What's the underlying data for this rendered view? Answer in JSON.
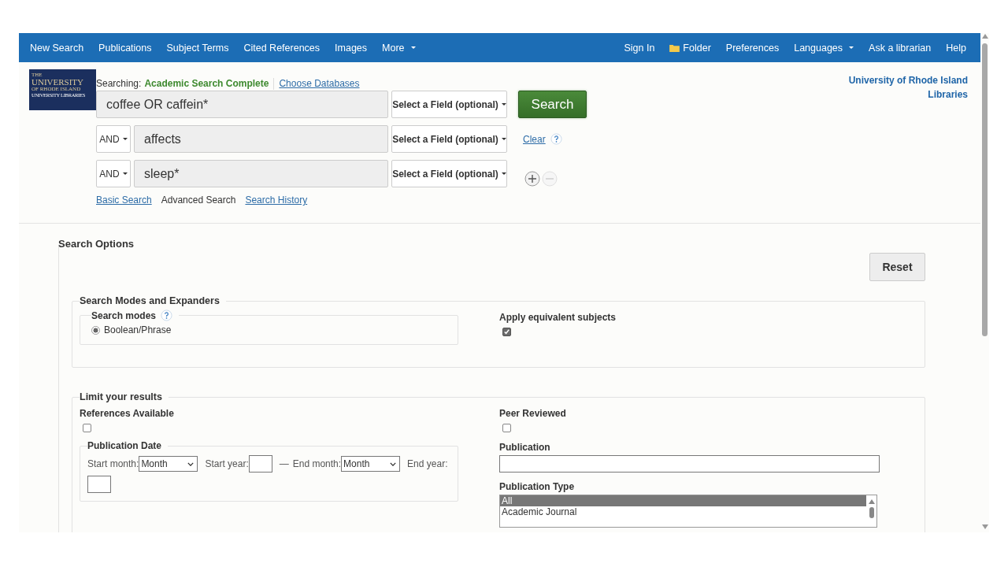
{
  "nav": {
    "left": [
      {
        "label": "New Search",
        "kind": "link"
      },
      {
        "label": "Publications",
        "kind": "link"
      },
      {
        "label": "Subject Terms",
        "kind": "link"
      },
      {
        "label": "Cited References",
        "kind": "link"
      },
      {
        "label": "Images",
        "kind": "link"
      },
      {
        "label": "More",
        "kind": "menu"
      }
    ],
    "right": [
      {
        "label": "Sign In",
        "kind": "link"
      },
      {
        "label": "Folder",
        "kind": "folder"
      },
      {
        "label": "Preferences",
        "kind": "link"
      },
      {
        "label": "Languages",
        "kind": "menu"
      },
      {
        "label": "Ask a librarian",
        "kind": "link"
      },
      {
        "label": "Help",
        "kind": "link"
      }
    ]
  },
  "logo": {
    "lines": [
      "THE",
      "UNIVERSITY",
      "OF RHODE ISLAND",
      "UNIVERSITY LIBRARIES"
    ]
  },
  "searching": {
    "label": "Searching:",
    "database": "Academic Search Complete",
    "choose": "Choose Databases"
  },
  "rows": [
    {
      "value": "coffee OR caffein*",
      "field": "Select a Field (optional)"
    },
    {
      "operator": "AND",
      "value": "affects",
      "field": "Select a Field (optional)"
    },
    {
      "operator": "AND",
      "value": "sleep*",
      "field": "Select a Field (optional)"
    }
  ],
  "search_button": "Search",
  "clear": "Clear",
  "remove_disabled": true,
  "mode_links": [
    {
      "label": "Basic Search",
      "selected": false
    },
    {
      "label": "Advanced Search",
      "selected": true
    },
    {
      "label": "Search History",
      "selected": false
    }
  ],
  "institution": "University of Rhode Island Libraries",
  "options": {
    "title": "Search Options",
    "reset": "Reset",
    "modes": {
      "title": "Search Modes and Expanders",
      "search_modes": "Search modes",
      "choices": [
        {
          "label": "Boolean/Phrase",
          "selected": true
        }
      ],
      "apply": {
        "label": "Apply equivalent subjects",
        "checked": true
      }
    },
    "limits": {
      "title": "Limit your results",
      "references": {
        "label": "References Available",
        "checked": false
      },
      "peer": {
        "label": "Peer Reviewed",
        "checked": false
      },
      "pub_date": {
        "title": "Publication Date",
        "start_month_label": "Start month:",
        "start_month": "Month",
        "start_year_label": "Start year:",
        "dash": "—",
        "end_month_label": "End month:",
        "end_month": "Month",
        "end_year_label": "End year:"
      },
      "publication": "Publication",
      "pub_type": {
        "label": "Publication Type",
        "options": [
          {
            "label": "All",
            "selected": true
          },
          {
            "label": "Academic Journal",
            "selected": false
          }
        ]
      }
    }
  }
}
